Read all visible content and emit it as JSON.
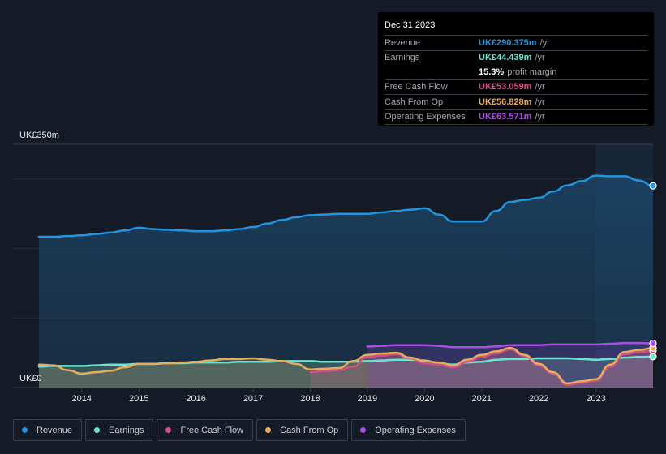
{
  "tooltip": {
    "date": "Dec 31 2023",
    "rows": [
      {
        "label": "Revenue",
        "value": "UK£290.375m",
        "unit": "/yr",
        "color": "#2394df"
      },
      {
        "label": "Earnings",
        "value": "UK£44.439m",
        "unit": "/yr",
        "color": "#6ee3cf"
      },
      {
        "label": "",
        "value": "15.3%",
        "unit": "profit margin",
        "color": "#ffffff"
      },
      {
        "label": "Free Cash Flow",
        "value": "UK£53.059m",
        "unit": "/yr",
        "color": "#d64f8a"
      },
      {
        "label": "Cash From Op",
        "value": "UK£56.828m",
        "unit": "/yr",
        "color": "#e8ad5c"
      },
      {
        "label": "Operating Expenses",
        "value": "UK£63.571m",
        "unit": "/yr",
        "color": "#a94fe6"
      }
    ]
  },
  "legend": [
    {
      "label": "Revenue",
      "color": "#2394df"
    },
    {
      "label": "Earnings",
      "color": "#6ee3cf"
    },
    {
      "label": "Free Cash Flow",
      "color": "#d64f8a"
    },
    {
      "label": "Cash From Op",
      "color": "#e8ad5c"
    },
    {
      "label": "Operating Expenses",
      "color": "#a94fe6"
    }
  ],
  "chart_data": {
    "type": "area",
    "title": "",
    "xlabel": "",
    "ylabel": "",
    "y_axis_labels": {
      "top": "UK£350m",
      "bottom": "UK£0"
    },
    "ylim": [
      0,
      350
    ],
    "xlim": [
      2013.25,
      2024.0
    ],
    "x_ticks": [
      2014,
      2015,
      2016,
      2017,
      2018,
      2019,
      2020,
      2021,
      2022,
      2023
    ],
    "grid": true,
    "highlight_start": 2023.0,
    "legend_position": "bottom-left",
    "series": [
      {
        "name": "Revenue",
        "color": "#2394df",
        "points": [
          [
            2013.25,
            217
          ],
          [
            2013.5,
            217
          ],
          [
            2013.75,
            218
          ],
          [
            2014.0,
            219
          ],
          [
            2014.25,
            221
          ],
          [
            2014.5,
            223
          ],
          [
            2014.75,
            226
          ],
          [
            2015.0,
            230
          ],
          [
            2015.25,
            228
          ],
          [
            2015.5,
            227
          ],
          [
            2015.75,
            226
          ],
          [
            2016.0,
            225
          ],
          [
            2016.25,
            225
          ],
          [
            2016.5,
            226
          ],
          [
            2016.75,
            228
          ],
          [
            2017.0,
            231
          ],
          [
            2017.25,
            236
          ],
          [
            2017.5,
            241
          ],
          [
            2017.75,
            245
          ],
          [
            2018.0,
            248
          ],
          [
            2018.25,
            249
          ],
          [
            2018.5,
            250
          ],
          [
            2018.75,
            250
          ],
          [
            2019.0,
            250
          ],
          [
            2019.25,
            252
          ],
          [
            2019.5,
            254
          ],
          [
            2019.75,
            256
          ],
          [
            2020.0,
            258
          ],
          [
            2020.25,
            249
          ],
          [
            2020.5,
            239
          ],
          [
            2020.75,
            239
          ],
          [
            2021.0,
            239
          ],
          [
            2021.25,
            254
          ],
          [
            2021.5,
            267
          ],
          [
            2021.75,
            270
          ],
          [
            2022.0,
            273
          ],
          [
            2022.25,
            282
          ],
          [
            2022.5,
            291
          ],
          [
            2022.75,
            297
          ],
          [
            2023.0,
            305
          ],
          [
            2023.25,
            304
          ],
          [
            2023.5,
            304
          ],
          [
            2023.75,
            298
          ],
          [
            2024.0,
            290.375
          ]
        ]
      },
      {
        "name": "Earnings",
        "color": "#6ee3cf",
        "points": [
          [
            2013.25,
            30
          ],
          [
            2013.5,
            31
          ],
          [
            2013.75,
            31
          ],
          [
            2014.0,
            31
          ],
          [
            2014.25,
            32
          ],
          [
            2014.5,
            33
          ],
          [
            2014.75,
            33
          ],
          [
            2015.0,
            34
          ],
          [
            2015.25,
            34
          ],
          [
            2015.5,
            35
          ],
          [
            2015.75,
            35
          ],
          [
            2016.0,
            36
          ],
          [
            2016.25,
            36
          ],
          [
            2016.5,
            36
          ],
          [
            2016.75,
            37
          ],
          [
            2017.0,
            37
          ],
          [
            2017.25,
            37
          ],
          [
            2017.5,
            38
          ],
          [
            2017.75,
            38
          ],
          [
            2018.0,
            38
          ],
          [
            2018.25,
            37
          ],
          [
            2018.5,
            37
          ],
          [
            2018.75,
            37
          ],
          [
            2019.0,
            38
          ],
          [
            2019.25,
            39
          ],
          [
            2019.5,
            40
          ],
          [
            2019.75,
            40
          ],
          [
            2020.0,
            39
          ],
          [
            2020.25,
            35
          ],
          [
            2020.5,
            33
          ],
          [
            2020.75,
            36
          ],
          [
            2021.0,
            37
          ],
          [
            2021.25,
            40
          ],
          [
            2021.5,
            41
          ],
          [
            2021.75,
            41
          ],
          [
            2022.0,
            42
          ],
          [
            2022.25,
            42
          ],
          [
            2022.5,
            42
          ],
          [
            2022.75,
            41
          ],
          [
            2023.0,
            40
          ],
          [
            2023.25,
            41
          ],
          [
            2023.5,
            43
          ],
          [
            2023.75,
            44
          ],
          [
            2024.0,
            44.439
          ]
        ]
      },
      {
        "name": "Free Cash Flow",
        "color": "#d64f8a",
        "points": [
          [
            2018.0,
            22
          ],
          [
            2018.25,
            24
          ],
          [
            2018.5,
            25
          ],
          [
            2018.75,
            30
          ],
          [
            2019.0,
            44
          ],
          [
            2019.25,
            46
          ],
          [
            2019.5,
            48
          ],
          [
            2019.75,
            42
          ],
          [
            2020.0,
            35
          ],
          [
            2020.25,
            33
          ],
          [
            2020.5,
            29
          ],
          [
            2020.75,
            37
          ],
          [
            2021.0,
            44
          ],
          [
            2021.25,
            49
          ],
          [
            2021.5,
            55
          ],
          [
            2021.75,
            45
          ],
          [
            2022.0,
            32
          ],
          [
            2022.25,
            20
          ],
          [
            2022.5,
            4
          ],
          [
            2022.75,
            7
          ],
          [
            2023.0,
            10
          ],
          [
            2023.25,
            30
          ],
          [
            2023.5,
            48
          ],
          [
            2023.75,
            51
          ],
          [
            2024.0,
            53.059
          ]
        ]
      },
      {
        "name": "Cash From Op",
        "color": "#e8ad5c",
        "points": [
          [
            2013.25,
            33
          ],
          [
            2013.5,
            32
          ],
          [
            2013.75,
            25
          ],
          [
            2014.0,
            20
          ],
          [
            2014.25,
            22
          ],
          [
            2014.5,
            24
          ],
          [
            2014.75,
            29
          ],
          [
            2015.0,
            34
          ],
          [
            2015.25,
            34
          ],
          [
            2015.5,
            35
          ],
          [
            2015.75,
            36
          ],
          [
            2016.0,
            37
          ],
          [
            2016.25,
            39
          ],
          [
            2016.5,
            41
          ],
          [
            2016.75,
            41
          ],
          [
            2017.0,
            42
          ],
          [
            2017.25,
            40
          ],
          [
            2017.5,
            38
          ],
          [
            2017.75,
            34
          ],
          [
            2018.0,
            26
          ],
          [
            2018.25,
            27
          ],
          [
            2018.5,
            28
          ],
          [
            2018.75,
            38
          ],
          [
            2019.0,
            47
          ],
          [
            2019.25,
            49
          ],
          [
            2019.5,
            50
          ],
          [
            2019.75,
            43
          ],
          [
            2020.0,
            38
          ],
          [
            2020.25,
            36
          ],
          [
            2020.5,
            32
          ],
          [
            2020.75,
            40
          ],
          [
            2021.0,
            47
          ],
          [
            2021.25,
            52
          ],
          [
            2021.5,
            57
          ],
          [
            2021.75,
            47
          ],
          [
            2022.0,
            34
          ],
          [
            2022.25,
            22
          ],
          [
            2022.5,
            6
          ],
          [
            2022.75,
            9
          ],
          [
            2023.0,
            12
          ],
          [
            2023.25,
            33
          ],
          [
            2023.5,
            51
          ],
          [
            2023.75,
            54
          ],
          [
            2024.0,
            56.828
          ]
        ]
      },
      {
        "name": "Operating Expenses",
        "color": "#a94fe6",
        "points": [
          [
            2019.0,
            59
          ],
          [
            2019.25,
            60
          ],
          [
            2019.5,
            61
          ],
          [
            2019.75,
            61
          ],
          [
            2020.0,
            61
          ],
          [
            2020.25,
            60
          ],
          [
            2020.5,
            58
          ],
          [
            2020.75,
            58
          ],
          [
            2021.0,
            58
          ],
          [
            2021.25,
            59
          ],
          [
            2021.5,
            61
          ],
          [
            2021.75,
            61
          ],
          [
            2022.0,
            61
          ],
          [
            2022.25,
            62
          ],
          [
            2022.5,
            62
          ],
          [
            2022.75,
            62
          ],
          [
            2023.0,
            62
          ],
          [
            2023.25,
            63
          ],
          [
            2023.5,
            64
          ],
          [
            2023.75,
            64
          ],
          [
            2024.0,
            63.571
          ]
        ]
      }
    ]
  }
}
